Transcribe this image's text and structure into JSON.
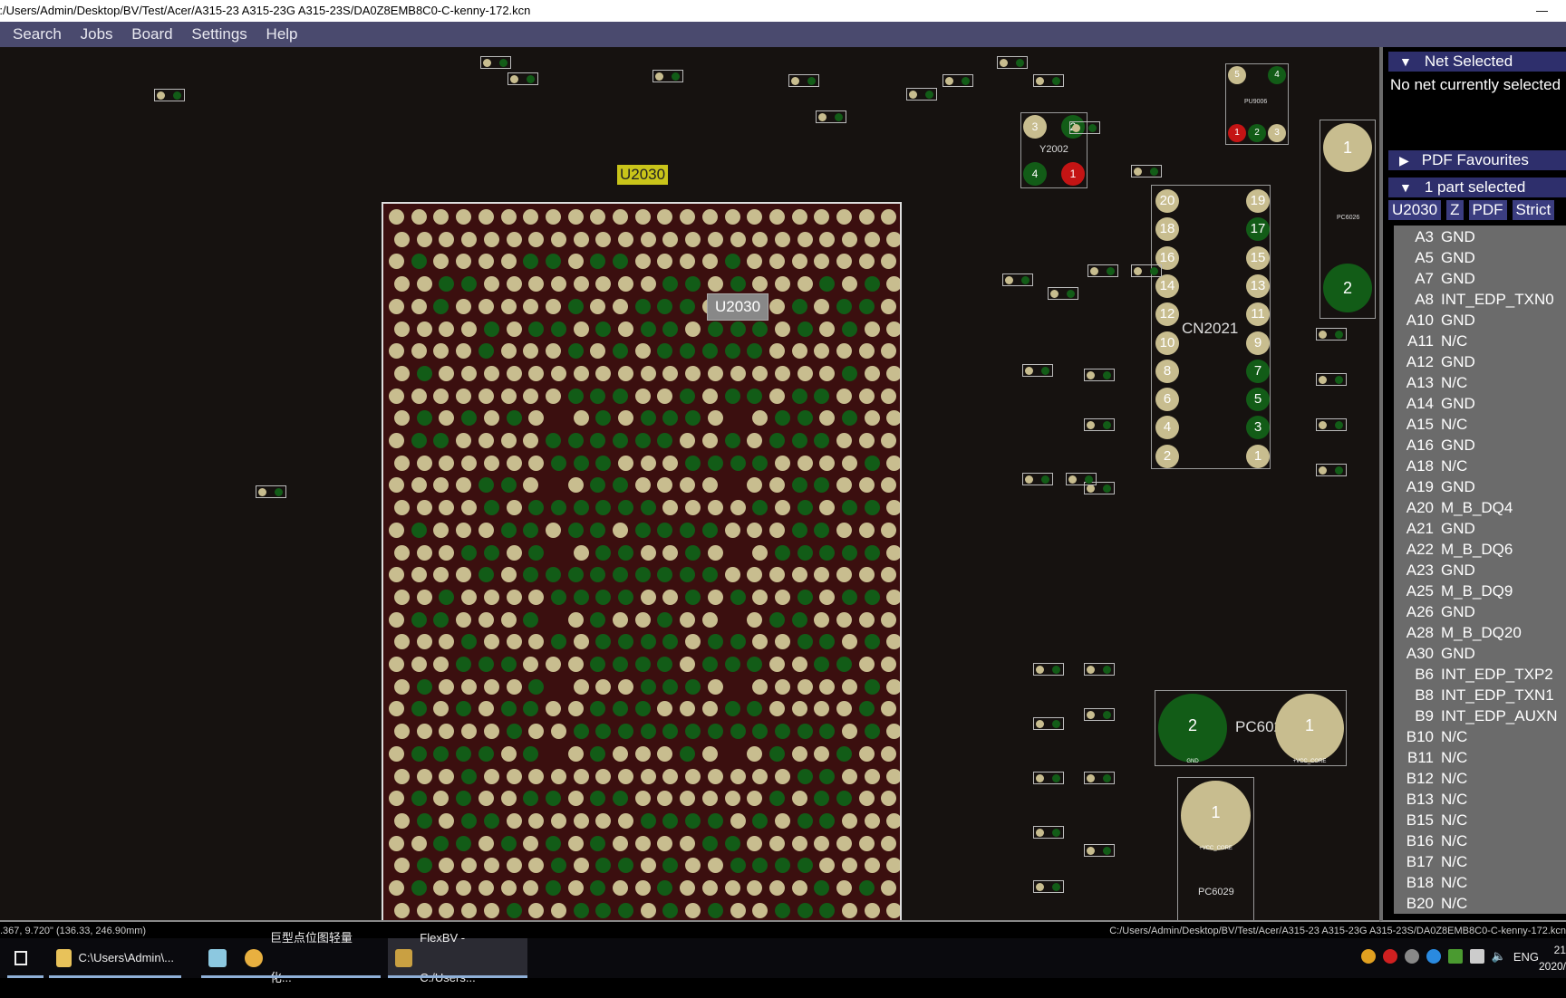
{
  "window": {
    "title": "C:/Users/Admin/Desktop/BV/Test/Acer/A315-23 A315-23G A315-23S/DA0Z8EMB8C0-C-kenny-172.kcn",
    "minimize": "—"
  },
  "menu": [
    "Search",
    "Jobs",
    "Board",
    "Settings",
    "Help"
  ],
  "board": {
    "selected_part_tag": "U2030",
    "tooltip": "U2030",
    "components": {
      "y2002": "Y2002",
      "pu9006": "PU9006",
      "cn2021": "CN2021",
      "pc6026": "PC6026",
      "pc6028": "PC6028",
      "pc6029": "PC6029"
    },
    "cn2021_left": [
      "20",
      "18",
      "16",
      "14",
      "12",
      "10",
      "8",
      "6",
      "4",
      "2"
    ],
    "cn2021_right": [
      "19",
      "17",
      "15",
      "13",
      "11",
      "9",
      "7",
      "5",
      "3",
      "1"
    ],
    "cn2021_green": [
      "17",
      "7",
      "5",
      "3"
    ],
    "pc6028_pins": {
      "p2": "2",
      "p2_net": "GND",
      "p1": "1",
      "p1_net": "+VCC_CORE"
    },
    "pc6029_pin": {
      "p1": "1",
      "net": "+VCC_CORE"
    },
    "pc6026_pins": [
      "1",
      "2"
    ],
    "y2002_pins": [
      "3",
      "2",
      "4",
      "1"
    ],
    "pu9006_pins": [
      "5",
      "4",
      "1",
      "2",
      "3"
    ],
    "colors": {
      "board_bg": "#161210",
      "bga_bg": "#3b0f0f",
      "pad_tan": "#c8bd8f",
      "pad_green": "#125c17",
      "pad_red": "#c41414"
    }
  },
  "panel": {
    "net_selected": {
      "header": "Net Selected",
      "text": "No net currently selected"
    },
    "pdf_favourites": {
      "header": "PDF Favourites"
    },
    "parts": {
      "header": "1 part selected",
      "buttons": [
        "U2030",
        "Z",
        "PDF",
        "Strict"
      ]
    },
    "pins": [
      [
        "A3",
        "GND"
      ],
      [
        "A5",
        "GND"
      ],
      [
        "A7",
        "GND"
      ],
      [
        "A8",
        "INT_EDP_TXN0"
      ],
      [
        "A10",
        "GND"
      ],
      [
        "A11",
        "N/C"
      ],
      [
        "A12",
        "GND"
      ],
      [
        "A13",
        "N/C"
      ],
      [
        "A14",
        "GND"
      ],
      [
        "A15",
        "N/C"
      ],
      [
        "A16",
        "GND"
      ],
      [
        "A18",
        "N/C"
      ],
      [
        "A19",
        "GND"
      ],
      [
        "A20",
        "M_B_DQ4"
      ],
      [
        "A21",
        "GND"
      ],
      [
        "A22",
        "M_B_DQ6"
      ],
      [
        "A23",
        "GND"
      ],
      [
        "A25",
        "M_B_DQ9"
      ],
      [
        "A26",
        "GND"
      ],
      [
        "A28",
        "M_B_DQ20"
      ],
      [
        "A30",
        "GND"
      ],
      [
        "B6",
        "INT_EDP_TXP2"
      ],
      [
        "B8",
        "INT_EDP_TXN1"
      ],
      [
        "B9",
        "INT_EDP_AUXN"
      ],
      [
        "B10",
        "N/C"
      ],
      [
        "B11",
        "N/C"
      ],
      [
        "B12",
        "N/C"
      ],
      [
        "B13",
        "N/C"
      ],
      [
        "B15",
        "N/C"
      ],
      [
        "B16",
        "N/C"
      ],
      [
        "B17",
        "N/C"
      ],
      [
        "B18",
        "N/C"
      ],
      [
        "B20",
        "N/C"
      ]
    ]
  },
  "status": {
    "coords": ".367, 9.720\" (136.33, 246.90mm)",
    "path": "C:/Users/Admin/Desktop/BV/Test/Acer/A315-23 A315-23G A315-23S/DA0Z8EMB8C0-C-kenny-172.kcn"
  },
  "taskbar": {
    "items": [
      "C:\\Users\\Admin\\...",
      "巨型点位图轻量化...",
      "FlexBV - C:/Users..."
    ],
    "lang": "ENG",
    "time": "21",
    "date": "2020/"
  }
}
